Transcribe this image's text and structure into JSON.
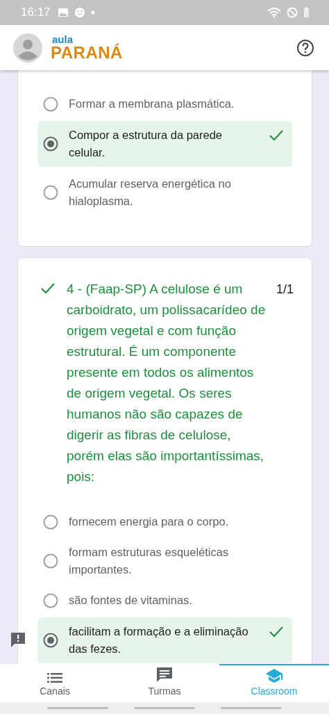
{
  "status_bar": {
    "time": "16:17"
  },
  "header": {
    "logo_top": "aula",
    "logo_bottom": "PARANÁ"
  },
  "cards": [
    {
      "options": [
        {
          "text": "Formar a membrana plasmática.",
          "selected": false,
          "correct": false
        },
        {
          "text": "Compor a estrutura da parede celular.",
          "selected": true,
          "correct": true
        },
        {
          "text": "Acumular reserva energética no hialoplasma.",
          "selected": false,
          "correct": false
        }
      ]
    },
    {
      "question": {
        "text": "4 - (Faap-SP) A celulose é um carboidrato, um polissacarídeo de origem vegetal e com função estrutural. É um componente presente em todos os alimentos de origem vegetal. Os seres humanos não são capazes de digerir as fibras de celulose, porém elas são importantíssimas, pois:",
        "score": "1/1",
        "correct": true
      },
      "options": [
        {
          "text": "fornecem energia para o corpo.",
          "selected": false,
          "correct": false
        },
        {
          "text": "formam estruturas esqueléticas importantes.",
          "selected": false,
          "correct": false
        },
        {
          "text": "são fontes de vitaminas.",
          "selected": false,
          "correct": false
        },
        {
          "text": "facilitam a formação e a eliminação das fezes.",
          "selected": true,
          "correct": true
        }
      ]
    }
  ],
  "nav": [
    {
      "label": "Canais",
      "kind": "list",
      "selected": false
    },
    {
      "label": "Turmas",
      "kind": "chat",
      "selected": false
    },
    {
      "label": "Classroom",
      "kind": "school",
      "selected": true
    }
  ]
}
